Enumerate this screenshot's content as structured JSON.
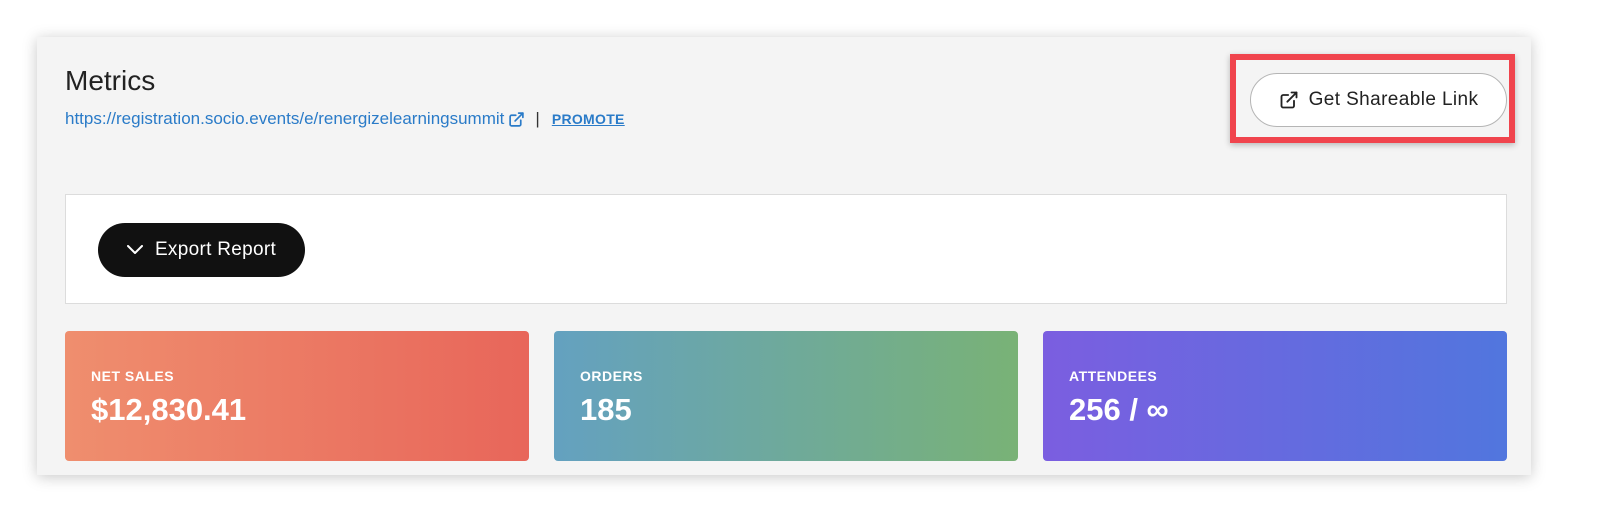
{
  "header": {
    "title": "Metrics",
    "url": "https://registration.socio.events/e/renergizelearningsummit",
    "separator": "|",
    "promote_label": "PROMOTE"
  },
  "actions": {
    "share_label": "Get Shareable Link",
    "export_label": "Export Report"
  },
  "stats": [
    {
      "label": "NET SALES",
      "value": "$12,830.41"
    },
    {
      "label": "ORDERS",
      "value": "185"
    },
    {
      "label": "ATTENDEES",
      "value": "256 / ∞"
    }
  ],
  "icons": {
    "external_link": "external-link-icon",
    "chevron": "chevron-down-icon"
  },
  "colors": {
    "link": "#2a7bc8",
    "highlight": "#f0444d",
    "export_button": "#111111",
    "net_sales_gradient": [
      "#ef8e6e",
      "#e8665a"
    ],
    "orders_gradient": [
      "#64a1c0",
      "#79b276"
    ],
    "attendees_gradient": [
      "#7b5ee0",
      "#5176de"
    ]
  }
}
